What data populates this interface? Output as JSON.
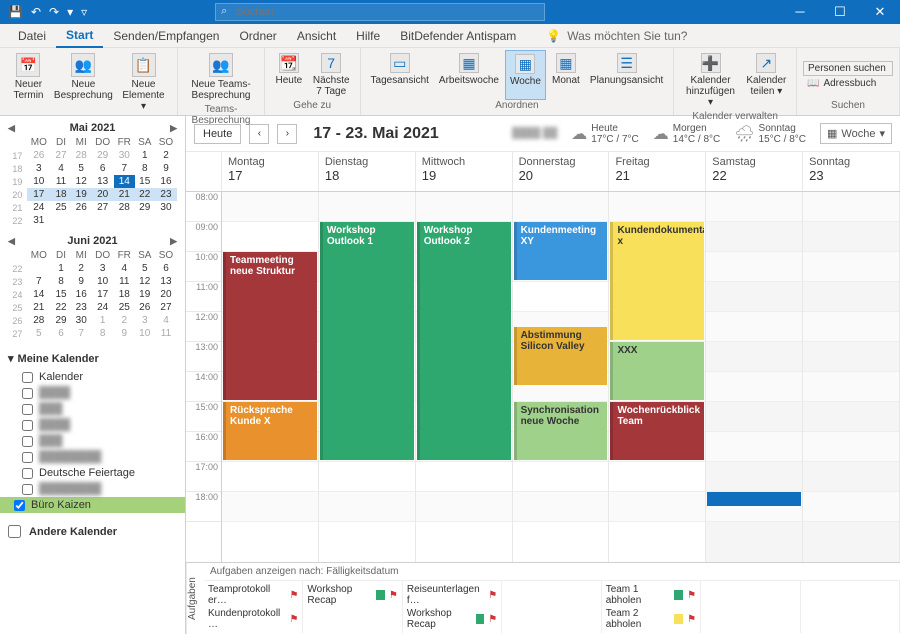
{
  "search_placeholder": "Suchen",
  "menu": {
    "datei": "Datei",
    "start": "Start",
    "senden": "Senden/Empfangen",
    "ordner": "Ordner",
    "ansicht": "Ansicht",
    "hilfe": "Hilfe",
    "bitdefender": "BitDefender Antispam",
    "tellme": "Was möchten Sie tun?"
  },
  "ribbon": {
    "neuer_termin": "Neuer\nTermin",
    "neue_besprechung": "Neue\nBesprechung",
    "neue_elemente": "Neue\nElemente ▾",
    "neu": "Neu",
    "teams_besprechung": "Neue Teams-\nBesprechung",
    "teams_grp": "Teams-Besprechung",
    "heute": "Heute",
    "naechste": "Nächste\n7 Tage",
    "gehe_zu": "Gehe zu",
    "tagesansicht": "Tagesansicht",
    "arbeitswoche": "Arbeitswoche",
    "woche": "Woche",
    "monat": "Monat",
    "planung": "Planungsansicht",
    "anordnen": "Anordnen",
    "kal_hinzu": "Kalender\nhinzufügen ▾",
    "kal_teilen": "Kalender\nteilen ▾",
    "kal_verwalten": "Kalender verwalten",
    "personen": "Personen suchen",
    "adressbuch": "Adressbuch",
    "suchen": "Suchen"
  },
  "minical1": {
    "title": "Mai 2021",
    "dow": [
      "MO",
      "DI",
      "MI",
      "DO",
      "FR",
      "SA",
      "SO"
    ],
    "weeks": [
      {
        "wk": "17",
        "d": [
          26,
          27,
          28,
          29,
          30,
          1,
          2
        ],
        "dim": [
          0,
          1,
          2,
          3,
          4
        ]
      },
      {
        "wk": "18",
        "d": [
          3,
          4,
          5,
          6,
          7,
          8,
          9
        ]
      },
      {
        "wk": "19",
        "d": [
          10,
          11,
          12,
          13,
          14,
          15,
          16
        ],
        "today": 4
      },
      {
        "wk": "20",
        "d": [
          17,
          18,
          19,
          20,
          21,
          22,
          23
        ],
        "sel": true
      },
      {
        "wk": "21",
        "d": [
          24,
          25,
          26,
          27,
          28,
          29,
          30
        ]
      },
      {
        "wk": "22",
        "d": [
          31
        ]
      }
    ]
  },
  "minical2": {
    "title": "Juni 2021",
    "dow": [
      "MO",
      "DI",
      "MI",
      "DO",
      "FR",
      "SA",
      "SO"
    ],
    "weeks": [
      {
        "wk": "22",
        "d": [
          "",
          1,
          2,
          3,
          4,
          5,
          6
        ]
      },
      {
        "wk": "23",
        "d": [
          7,
          8,
          9,
          10,
          11,
          12,
          13
        ]
      },
      {
        "wk": "24",
        "d": [
          14,
          15,
          16,
          17,
          18,
          19,
          20
        ]
      },
      {
        "wk": "25",
        "d": [
          21,
          22,
          23,
          24,
          25,
          26,
          27
        ]
      },
      {
        "wk": "26",
        "d": [
          28,
          29,
          30,
          1,
          2,
          3,
          4
        ],
        "dim": [
          3,
          4,
          5,
          6
        ]
      },
      {
        "wk": "27",
        "d": [
          5,
          6,
          7,
          8,
          9,
          10,
          11
        ],
        "dim": [
          0,
          1,
          2,
          3,
          4,
          5,
          6
        ]
      }
    ]
  },
  "callist": {
    "meine": "Meine Kalender",
    "kalender": "Kalender",
    "feiertage": "Deutsche Feiertage",
    "buero": "Büro Kaizen",
    "andere": "Andere Kalender"
  },
  "cal": {
    "heute_btn": "Heute",
    "range": "17 - 23. Mai 2021",
    "view": "Woche",
    "weather": [
      {
        "name": "Heute",
        "temp": "17°C / 7°C"
      },
      {
        "name": "Morgen",
        "temp": "14°C / 8°C"
      },
      {
        "name": "Sonntag",
        "temp": "15°C / 8°C"
      }
    ],
    "days": [
      {
        "name": "Montag",
        "num": "17"
      },
      {
        "name": "Dienstag",
        "num": "18"
      },
      {
        "name": "Mittwoch",
        "num": "19"
      },
      {
        "name": "Donnerstag",
        "num": "20"
      },
      {
        "name": "Freitag",
        "num": "21"
      },
      {
        "name": "Samstag",
        "num": "22"
      },
      {
        "name": "Sonntag",
        "num": "23"
      }
    ],
    "hours": [
      "08:00",
      "09:00",
      "10:00",
      "11:00",
      "12:00",
      "13:00",
      "14:00",
      "15:00",
      "16:00",
      "17:00",
      "18:00"
    ],
    "events": [
      {
        "day": 0,
        "start": 10,
        "end": 15,
        "title": "Teammeeting neue Struktur",
        "color": "#a4373a"
      },
      {
        "day": 0,
        "start": 15,
        "end": 17,
        "title": "Rücksprache Kunde X",
        "color": "#e8912d"
      },
      {
        "day": 1,
        "start": 9,
        "end": 17,
        "title": "Workshop Outlook 1",
        "color": "#2fa86f"
      },
      {
        "day": 2,
        "start": 9,
        "end": 17,
        "title": "Workshop Outlook 2",
        "color": "#2fa86f"
      },
      {
        "day": 3,
        "start": 9,
        "end": 11,
        "title": "Kundenmeeting XY",
        "color": "#3a96dd"
      },
      {
        "day": 3,
        "start": 12.5,
        "end": 14.5,
        "title": "Abstimmung Silicon Valley",
        "color": "#e8b339",
        "tcolor": "#333"
      },
      {
        "day": 3,
        "start": 15,
        "end": 17,
        "title": "Synchronisation neue Woche",
        "color": "#9fd18b",
        "tcolor": "#333"
      },
      {
        "day": 4,
        "start": 9,
        "end": 13,
        "title": "Kundendokumentation x",
        "color": "#f8e05a",
        "tcolor": "#333"
      },
      {
        "day": 4,
        "start": 13,
        "end": 15,
        "title": "XXX",
        "color": "#9fd18b",
        "tcolor": "#333"
      },
      {
        "day": 4,
        "start": 15,
        "end": 17,
        "title": "Wochenrückblick Team",
        "color": "#a4373a"
      }
    ]
  },
  "tasks": {
    "label": "Aufgaben",
    "header": "Aufgaben anzeigen nach: Fälligkeitsdatum",
    "cols": [
      [
        {
          "t": "Teamprotokoll er…",
          "c": ""
        },
        {
          "t": "Kundenprotokoll …",
          "c": ""
        }
      ],
      [
        {
          "t": "Workshop Recap",
          "c": "#2fa86f"
        }
      ],
      [
        {
          "t": "Reiseunterlagen f…",
          "c": ""
        },
        {
          "t": "Workshop Recap",
          "c": "#2fa86f"
        }
      ],
      [],
      [
        {
          "t": "Team 1 abholen",
          "c": "#2fa86f"
        },
        {
          "t": "Team 2 abholen",
          "c": "#f8e05a"
        }
      ],
      [],
      []
    ]
  }
}
